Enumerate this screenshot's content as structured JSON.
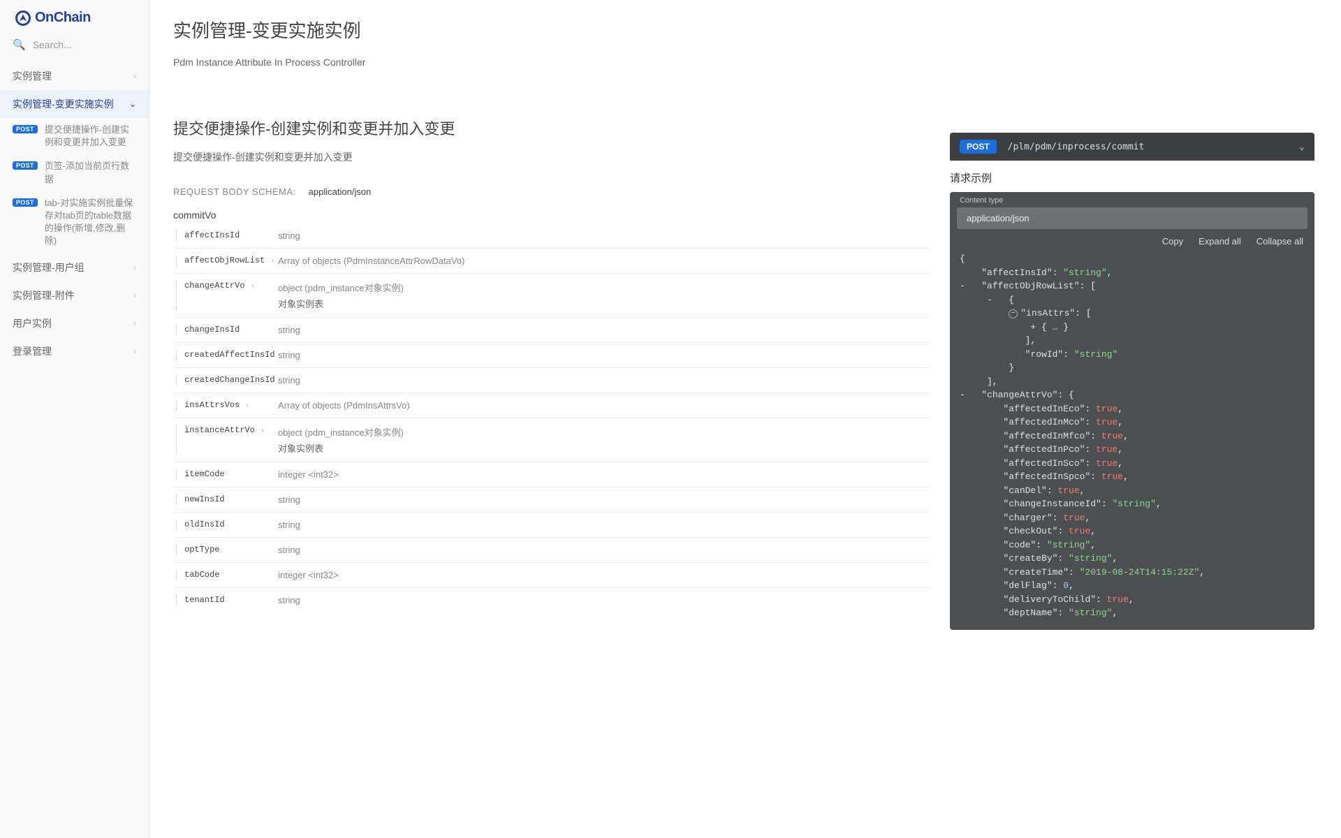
{
  "brand": "OnChain",
  "search": {
    "placeholder": "Search..."
  },
  "sidebar": {
    "groups": [
      {
        "label": "实例管理",
        "expand": "right"
      },
      {
        "label": "实例管理-变更实施实例",
        "expand": "down",
        "active": true,
        "children": [
          {
            "method": "POST",
            "label": "提交便捷操作-创建实例和变更并加入变更"
          },
          {
            "method": "POST",
            "label": "页签-添加当前页行数据"
          },
          {
            "method": "POST",
            "label": "tab-对实施实例批量保存对tab页的table数据的操作(新增,修改,删除)"
          }
        ]
      },
      {
        "label": "实例管理-用户组",
        "expand": "right"
      },
      {
        "label": "实例管理-附件",
        "expand": "right"
      },
      {
        "label": "用户实例",
        "expand": "right"
      },
      {
        "label": "登录管理",
        "expand": "right"
      }
    ]
  },
  "page": {
    "title": "实例管理-变更实施实例",
    "controller": "Pdm Instance Attribute In Process Controller",
    "op_title": "提交便捷操作-创建实例和变更并加入变更",
    "op_sub": "提交便捷操作-创建实例和变更并加入变更",
    "schema_label": "REQUEST BODY SCHEMA:",
    "schema_ct": "application/json",
    "schema_name": "commitVo",
    "fields": [
      {
        "key": "affectInsId",
        "type": "string"
      },
      {
        "key": "affectObjRowList",
        "type": "Array of objects (PdmInstanceAttrRowDataVo)",
        "arrow": true
      },
      {
        "key": "changeAttrVo",
        "type": "object (pdm_instance对象实例)",
        "desc": "对象实例表",
        "arrow": true
      },
      {
        "key": "changeInsId",
        "type": "string"
      },
      {
        "key": "createdAffectInsId",
        "type": "string"
      },
      {
        "key": "createdChangeInsId",
        "type": "string"
      },
      {
        "key": "insAttrsVos",
        "type": "Array of objects (PdmInsAttrsVo)",
        "arrow": true
      },
      {
        "key": "instanceAttrVo",
        "type": "object (pdm_instance对象实例)",
        "desc": "对象实例表",
        "arrow": true
      },
      {
        "key": "itemCode",
        "type": "integer <int32>"
      },
      {
        "key": "newInsId",
        "type": "string"
      },
      {
        "key": "oldInsId",
        "type": "string"
      },
      {
        "key": "optType",
        "type": "string"
      },
      {
        "key": "tabCode",
        "type": "integer <int32>"
      },
      {
        "key": "tenantId",
        "type": "string"
      }
    ]
  },
  "request": {
    "method": "POST",
    "path": "/plm/pdm/inprocess/commit",
    "example_heading": "请求示例",
    "content_type_label": "Content type",
    "content_type_value": "application/json",
    "tools": {
      "copy": "Copy",
      "expand": "Expand all",
      "collapse": "Collapse all"
    },
    "json": {
      "affectInsId": "string",
      "affectObjRowList_note": "array with object containing insAttrs: [ { … } ] and rowId: string",
      "changeAttrVo": {
        "affectedInEco": true,
        "affectedInMco": true,
        "affectedInMfco": true,
        "affectedInPco": true,
        "affectedInSco": true,
        "affectedInSpco": true,
        "canDel": true,
        "changeInstanceId": "string",
        "charger": true,
        "checkOut": true,
        "code": "string",
        "createBy": "string",
        "createTime": "2019-08-24T14:15:22Z",
        "delFlag": 0,
        "deliveryToChild": true,
        "deptName": "string"
      }
    }
  }
}
